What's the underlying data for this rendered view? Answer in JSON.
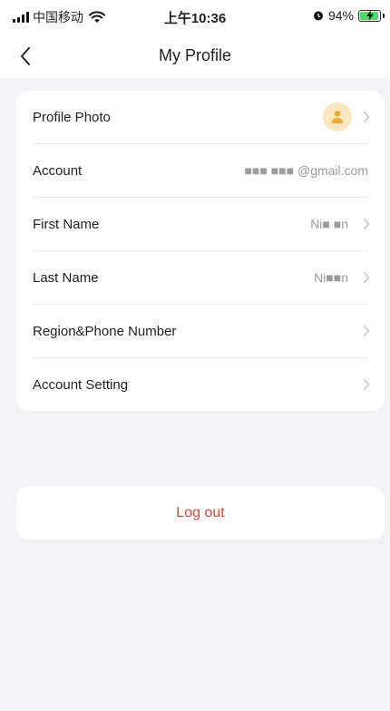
{
  "status_bar": {
    "carrier": "中国移动",
    "time": "上午10:36",
    "battery_percent": "94%",
    "battery_color": "#4cd964"
  },
  "nav": {
    "title": "My Profile",
    "back_icon": "chevron-left-icon"
  },
  "profile": {
    "rows": [
      {
        "label": "Profile Photo",
        "value": "",
        "icon": "avatar-person-icon",
        "avatar_color": "#f0a92a"
      },
      {
        "label": "Account",
        "value": "■■■ ■■■ @gmail.com"
      },
      {
        "label": "First Name",
        "value": "Ni■ ■n"
      },
      {
        "label": "Last Name",
        "value": "Ni■■n"
      },
      {
        "label": "Region&Phone Number",
        "value": ""
      },
      {
        "label": "Account Setting",
        "value": ""
      }
    ]
  },
  "logout": {
    "label": "Log out",
    "color": "#d9463a"
  }
}
